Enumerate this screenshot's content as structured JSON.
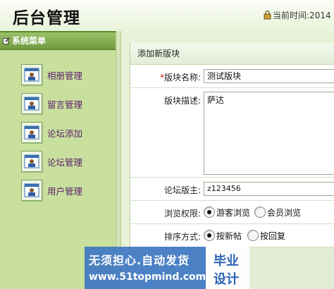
{
  "header": {
    "title": "后台管理",
    "time_label": "当前时间:",
    "time_value": "2014"
  },
  "sidebar": {
    "heading": "系统菜单",
    "items": [
      {
        "label": "相册管理",
        "icon": "user-card-icon"
      },
      {
        "label": "留言管理",
        "icon": "user-card-icon"
      },
      {
        "label": "论坛添加",
        "icon": "user-card-icon"
      },
      {
        "label": "论坛管理",
        "icon": "user-card-icon"
      },
      {
        "label": "用户管理",
        "icon": "user-card-icon"
      }
    ]
  },
  "form": {
    "title": "添加新版块",
    "name_required_mark": "*",
    "name_label": "版块名称:",
    "name_value": "测试版块",
    "desc_label": "版块描述:",
    "desc_value": "萨达",
    "owner_label": "论坛版主:",
    "owner_value": "z123456",
    "permission_label": "浏览权限:",
    "permission_options": [
      "游客浏览",
      "会员浏览"
    ],
    "permission_selected": "游客浏览",
    "sort_label": "排序方式:",
    "sort_options": [
      "按新帖",
      "按回复"
    ],
    "sort_selected": "按新帖"
  },
  "watermark": {
    "line1": "无须担心.自动发货",
    "line2": "www.51topmind.com",
    "right1": "毕业",
    "right2": "设计"
  },
  "colors": {
    "sidebar_bg": "#c8df9e",
    "sidebar_header": "#6f9a3c",
    "menu_text": "#5a1d6a",
    "watermark_blue": "#3f77c3"
  }
}
